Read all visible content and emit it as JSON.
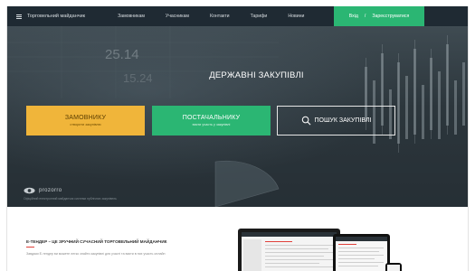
{
  "navbar": {
    "menu_icon": "hamburger-icon",
    "brand": "Торговельний майданчик",
    "links": [
      "Замовникам",
      "Учасникам",
      "Контакти",
      "Тарифи",
      "Новини"
    ],
    "login": "Вхід",
    "login_separator": "/",
    "register": "Зареєструватися",
    "colors": {
      "bar": "#1f2a33",
      "login": "#2bb673"
    }
  },
  "hero": {
    "title": "ДЕРЖАВНІ ЗАКУПІВЛІ",
    "chart_numbers": [
      "25.14",
      "15.24"
    ],
    "buttons": {
      "customer": {
        "label": "ЗАМОВНИКУ",
        "sublabel": "створити закупівлю",
        "color": "#f0b53a"
      },
      "supplier": {
        "label": "ПОСТАЧАЛЬНИКУ",
        "sublabel": "взяти участь у закупівлі",
        "color": "#2bb673"
      },
      "search": {
        "label": "ПОШУК ЗАКУПІВЛІ",
        "icon": "search-icon"
      }
    },
    "logo": {
      "text": "prozorro",
      "caption": "Офіційний електронний майданчик системи публічних закупівель"
    }
  },
  "content": {
    "title": "Е-ТЕНДЕР – ЦЕ ЗРУЧНИЙ СУЧАСНИЙ ТОРГОВЕЛЬНИЙ МАЙДАНЧИК",
    "text": "Завдяки Е-тендер ви можете легко знайти закупівлі для участі та взяти в них участь онлайн"
  }
}
